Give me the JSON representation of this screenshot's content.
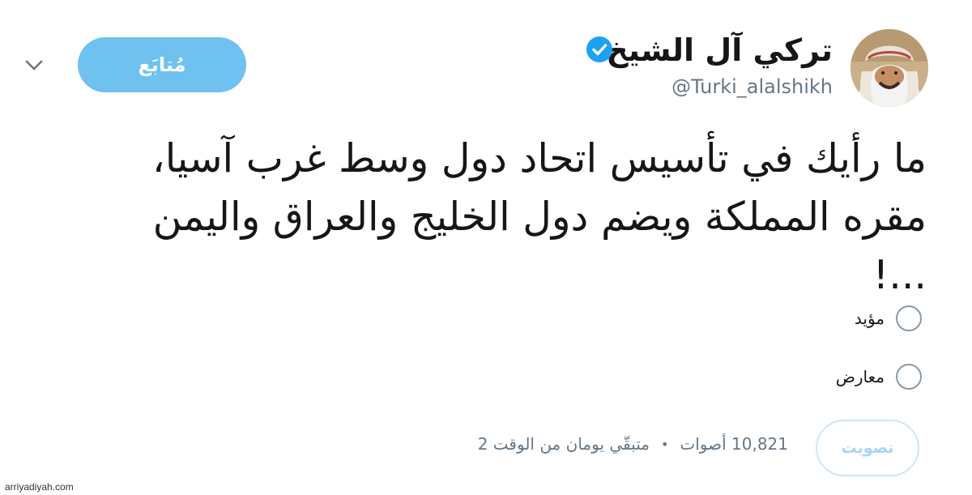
{
  "author": {
    "name": "تركي آل الشيخ",
    "handle": "@Turki_alalshikh",
    "verified": true
  },
  "follow_button": {
    "label": "مُتابَع"
  },
  "tweet": {
    "lines": [
      "ما رأيك في تأسيس اتحاد دول وسط غرب آسيا،",
      "مقره المملكة ويضم دول الخليج والعراق واليمن",
      "...!"
    ]
  },
  "poll": {
    "options": [
      {
        "label": "مؤيد"
      },
      {
        "label": "معارض"
      }
    ],
    "vote_button_label": "تصويت",
    "votes_text": "10,821 أصوات",
    "separator": "•",
    "time_left_text": "متبقّي يومان من الوقت 2"
  },
  "watermark": "arriyadiyah.com",
  "colors": {
    "accent": "#6fc1f0",
    "verified_badge": "#1da1f2",
    "secondary_text": "#657786"
  },
  "icons": {
    "verified": "verified-badge-icon",
    "more": "chevron-down-icon"
  }
}
